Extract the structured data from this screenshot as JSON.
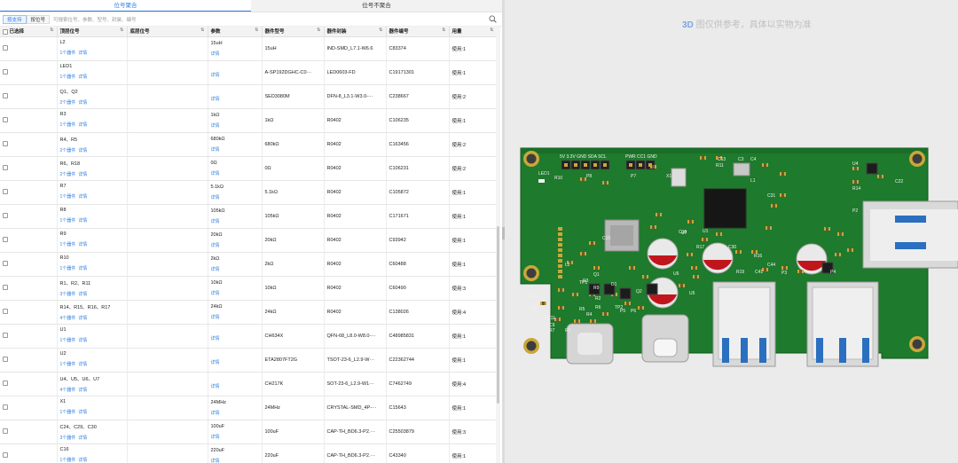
{
  "tabs": [
    {
      "label": "位号聚合",
      "active": true
    },
    {
      "label": "位号不聚合",
      "active": false
    }
  ],
  "search": {
    "mode_buttons": [
      "按支持",
      "按位号"
    ],
    "placeholder": "可搜索位号、参数、型号、封装、编号"
  },
  "table": {
    "columns": [
      "已选择",
      "顶层位号",
      "底层位号",
      "参数",
      "器件型号",
      "器件封装",
      "器件编号",
      "用量"
    ],
    "rows": [
      {
        "top": "L2",
        "count": "1个器件",
        "detail": "详情",
        "param": "15uH",
        "param_detail": "详情",
        "model": "15uH",
        "package": "IND-SMD_L7.1-W6.6",
        "code": "C83374",
        "qty": "使用:1"
      },
      {
        "top": "LED1",
        "count": "1个器件",
        "detail": "详情",
        "param": "",
        "param_detail": "详情",
        "model": "A-SP192DGHC-C0···",
        "package": "LED0603-FD",
        "code": "C19171301",
        "qty": "使用:1"
      },
      {
        "top": "Q1、Q2",
        "count": "2个器件",
        "detail": "详情",
        "param": "",
        "param_detail": "详情",
        "model": "SED3080M",
        "package": "DFN-8_L3.1-W3.0-···",
        "code": "C238667",
        "qty": "使用:2"
      },
      {
        "top": "R3",
        "count": "1个器件",
        "detail": "详情",
        "param": "1kΩ",
        "param_detail": "详情",
        "model": "1kΩ",
        "package": "R0402",
        "code": "C106235",
        "qty": "使用:1"
      },
      {
        "top": "R4、R5",
        "count": "2个器件",
        "detail": "详情",
        "param": "680kΩ",
        "param_detail": "详情",
        "model": "680kΩ",
        "package": "R0402",
        "code": "C163456",
        "qty": "使用:2"
      },
      {
        "top": "R6、R18",
        "count": "2个器件",
        "detail": "详情",
        "param": "0Ω",
        "param_detail": "详情",
        "model": "0Ω",
        "package": "R0402",
        "code": "C106231",
        "qty": "使用:2"
      },
      {
        "top": "R7",
        "count": "1个器件",
        "detail": "详情",
        "param": "5.1kΩ",
        "param_detail": "详情",
        "model": "5.1kΩ",
        "package": "R0402",
        "code": "C105872",
        "qty": "使用:1"
      },
      {
        "top": "R8",
        "count": "1个器件",
        "detail": "详情",
        "param": "105kΩ",
        "param_detail": "详情",
        "model": "105kΩ",
        "package": "R0402",
        "code": "C171671",
        "qty": "使用:1"
      },
      {
        "top": "R9",
        "count": "1个器件",
        "detail": "详情",
        "param": "20kΩ",
        "param_detail": "详情",
        "model": "20kΩ",
        "package": "R0402",
        "code": "C93942",
        "qty": "使用:1"
      },
      {
        "top": "R10",
        "count": "1个器件",
        "detail": "详情",
        "param": "2kΩ",
        "param_detail": "详情",
        "model": "2kΩ",
        "package": "R0402",
        "code": "C60488",
        "qty": "使用:1"
      },
      {
        "top": "R1、R2、R11",
        "count": "3个器件",
        "detail": "详情",
        "param": "10kΩ",
        "param_detail": "详情",
        "model": "10kΩ",
        "package": "R0402",
        "code": "C60490",
        "qty": "使用:3"
      },
      {
        "top": "R14、R15、R16、R17",
        "count": "4个器件",
        "detail": "详情",
        "param": "24kΩ",
        "param_detail": "详情",
        "model": "24kΩ",
        "package": "R0402",
        "code": "C138026",
        "qty": "使用:4"
      },
      {
        "top": "U1",
        "count": "1个器件",
        "detail": "详情",
        "param": "",
        "param_detail": "详情",
        "model": "CH634X",
        "package": "QFN-68_L8.0-W8.0-···",
        "code": "C48985831",
        "qty": "使用:1"
      },
      {
        "top": "U2",
        "count": "1个器件",
        "detail": "详情",
        "param": "",
        "param_detail": "详情",
        "model": "ETA2807FT2G",
        "package": "TSOT-23-6_L2.9-W···",
        "code": "C22362744",
        "qty": "使用:1"
      },
      {
        "top": "U4、U5、U6、U7",
        "count": "4个器件",
        "detail": "详情",
        "param": "",
        "param_detail": "详情",
        "model": "CH217K",
        "package": "SOT-23-6_L2.9-W1···",
        "code": "C7462749",
        "qty": "使用:4"
      },
      {
        "top": "X1",
        "count": "1个器件",
        "detail": "详情",
        "param": "24MHz",
        "param_detail": "详情",
        "model": "24MHz",
        "package": "CRYSTAL-SMD_4P-···",
        "code": "C15643",
        "qty": "使用:1"
      },
      {
        "top": "C24、C29、C30",
        "count": "3个器件",
        "detail": "详情",
        "param": "100uF",
        "param_detail": "详情",
        "model": "100uF",
        "package": "CAP-TH_BD6.3-P2.···",
        "code": "C25503879",
        "qty": "使用:3"
      },
      {
        "top": "C16",
        "count": "1个器件",
        "detail": "详情",
        "param": "220uF",
        "param_detail": "详情",
        "model": "220uF",
        "package": "CAP-TH_BD6.3-P2.···",
        "code": "C43340",
        "qty": "使用:1"
      }
    ]
  },
  "preview": {
    "note_prefix": "3D",
    "note_text": "图仅供参考，具体以实物为准",
    "header_labels": "5V 3.3V GND SDA SCL",
    "header2_labels": "PWR CC1 GND",
    "silk": [
      "LED1",
      "R10",
      "P8",
      "P7",
      "X1",
      "U1",
      "L1",
      "U4",
      "R14",
      "C22",
      "P2",
      "C16",
      "C30",
      "R17",
      "R16",
      "C44",
      "C41",
      "R19",
      "P4",
      "P3",
      "U6",
      "U7",
      "C15",
      "L2",
      "TP1",
      "R9",
      "D1",
      "R3",
      "Q1",
      "Q2",
      "R2",
      "R6",
      "R5",
      "R4",
      "P5",
      "P6",
      "U2",
      "U5",
      "TP2",
      "C23",
      "C11",
      "C9",
      "R7",
      "R1",
      "C2",
      "C3",
      "C4",
      "C13",
      "R11",
      "C31"
    ],
    "colors": {
      "board": "#1e7a2c",
      "silk": "#f2f2f2",
      "pad": "#caa73a",
      "usb_blue": "#2b6fc0"
    }
  }
}
